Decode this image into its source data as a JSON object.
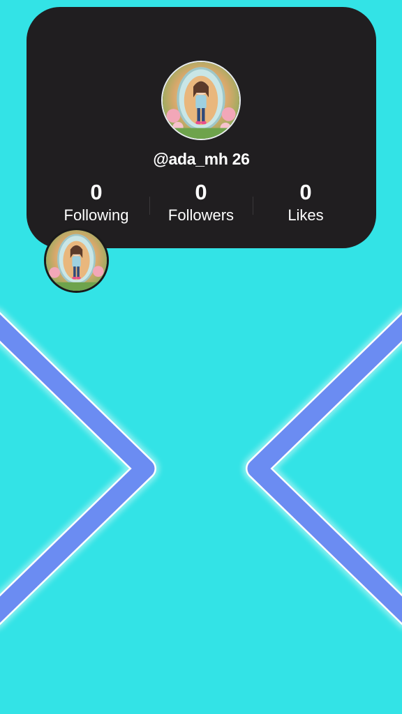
{
  "profile": {
    "username": "@ada_mh 26",
    "stats": [
      {
        "value": "0",
        "label": "Following"
      },
      {
        "value": "0",
        "label": "Followers"
      },
      {
        "value": "0",
        "label": "Likes"
      }
    ]
  },
  "icons": {
    "avatar": "avatar-image",
    "left_chevron": "chevron-left-icon",
    "right_chevron": "chevron-right-icon"
  },
  "colors": {
    "background": "#33e3e6",
    "card": "#201e20",
    "chevron": "#6b8cf2",
    "chevron_outline": "#ffffff"
  }
}
